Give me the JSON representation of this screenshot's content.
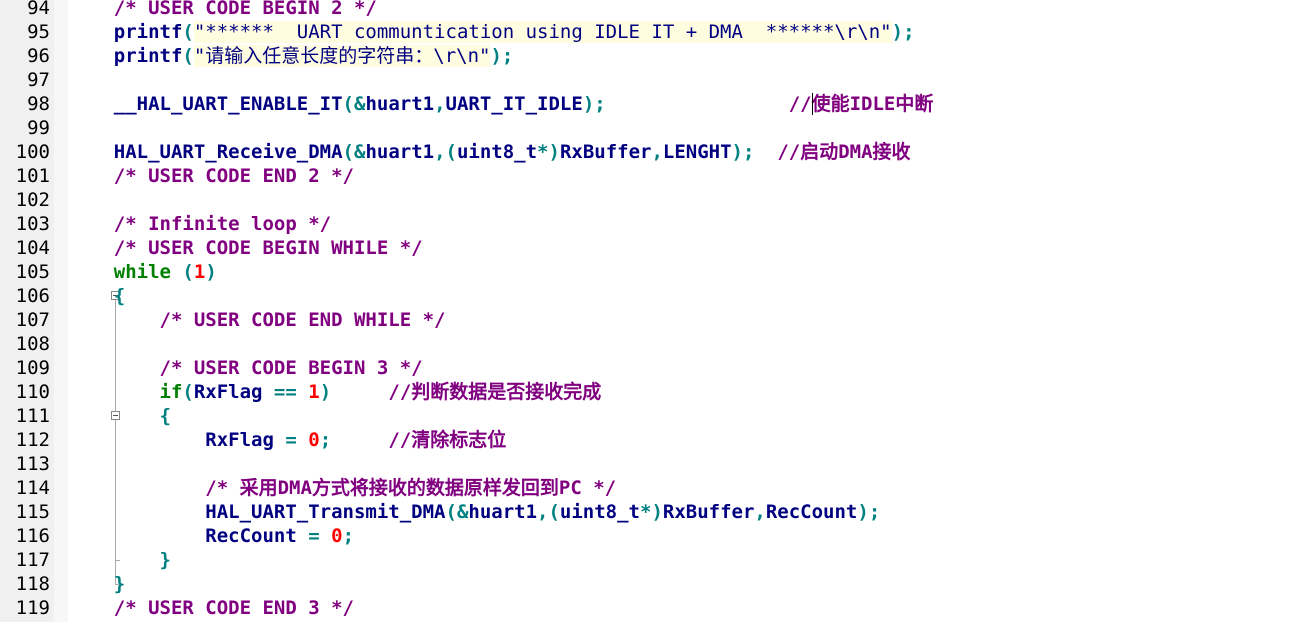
{
  "editor": {
    "lines": [
      {
        "num": "94",
        "segments": [
          {
            "c": "cmt",
            "t": "    /* USER CODE BEGIN 2 */"
          }
        ]
      },
      {
        "num": "95",
        "segments": [
          {
            "c": "fn",
            "t": "    printf"
          },
          {
            "c": "op",
            "t": "("
          },
          {
            "c": "str",
            "t": "\"******  UART communtication using IDLE IT + DMA  ******\\r\\n\""
          },
          {
            "c": "op",
            "t": ");"
          }
        ]
      },
      {
        "num": "96",
        "segments": [
          {
            "c": "fn",
            "t": "    printf"
          },
          {
            "c": "op",
            "t": "("
          },
          {
            "c": "str",
            "t": "\"请输入任意长度的字符串：\\r\\n\""
          },
          {
            "c": "op",
            "t": ");"
          }
        ]
      },
      {
        "num": "97",
        "segments": []
      },
      {
        "num": "98",
        "segments": [
          {
            "c": "plain",
            "t": "    __HAL_UART_ENABLE_IT"
          },
          {
            "c": "op",
            "t": "(&"
          },
          {
            "c": "plain",
            "t": "huart1"
          },
          {
            "c": "op",
            "t": ","
          },
          {
            "c": "plain",
            "t": "UART_IT_IDLE"
          },
          {
            "c": "op",
            "t": ");"
          },
          {
            "c": "plain",
            "t": "                "
          },
          {
            "c": "cmt",
            "t": "//使能IDLE中断"
          }
        ]
      },
      {
        "num": "99",
        "segments": []
      },
      {
        "num": "100",
        "segments": [
          {
            "c": "plain",
            "t": "    HAL_UART_Receive_DMA"
          },
          {
            "c": "op",
            "t": "(&"
          },
          {
            "c": "plain",
            "t": "huart1"
          },
          {
            "c": "op",
            "t": ",("
          },
          {
            "c": "plain",
            "t": "uint8_t"
          },
          {
            "c": "op",
            "t": "*)"
          },
          {
            "c": "plain",
            "t": "RxBuffer"
          },
          {
            "c": "op",
            "t": ","
          },
          {
            "c": "plain",
            "t": "LENGHT"
          },
          {
            "c": "op",
            "t": ");"
          },
          {
            "c": "plain",
            "t": "  "
          },
          {
            "c": "cmt",
            "t": "//启动DMA接收"
          }
        ]
      },
      {
        "num": "101",
        "segments": [
          {
            "c": "cmt",
            "t": "    /* USER CODE END 2 */"
          }
        ]
      },
      {
        "num": "102",
        "segments": []
      },
      {
        "num": "103",
        "segments": [
          {
            "c": "cmt",
            "t": "    /* Infinite loop */"
          }
        ]
      },
      {
        "num": "104",
        "segments": [
          {
            "c": "cmt",
            "t": "    /* USER CODE BEGIN WHILE */"
          }
        ]
      },
      {
        "num": "105",
        "segments": [
          {
            "c": "kw",
            "t": "    while"
          },
          {
            "c": "plain",
            "t": " "
          },
          {
            "c": "op",
            "t": "("
          },
          {
            "c": "num",
            "t": "1"
          },
          {
            "c": "op",
            "t": ")"
          }
        ]
      },
      {
        "num": "106",
        "segments": [
          {
            "c": "op",
            "t": "    {"
          }
        ]
      },
      {
        "num": "107",
        "segments": [
          {
            "c": "cmt",
            "t": "        /* USER CODE END WHILE */"
          }
        ]
      },
      {
        "num": "108",
        "segments": []
      },
      {
        "num": "109",
        "segments": [
          {
            "c": "cmt",
            "t": "        /* USER CODE BEGIN 3 */"
          }
        ]
      },
      {
        "num": "110",
        "segments": [
          {
            "c": "kw",
            "t": "        if"
          },
          {
            "c": "op",
            "t": "("
          },
          {
            "c": "plain",
            "t": "RxFlag "
          },
          {
            "c": "op",
            "t": "=="
          },
          {
            "c": "plain",
            "t": " "
          },
          {
            "c": "num",
            "t": "1"
          },
          {
            "c": "op",
            "t": ")"
          },
          {
            "c": "plain",
            "t": "     "
          },
          {
            "c": "cmt",
            "t": "//判断数据是否接收完成"
          }
        ]
      },
      {
        "num": "111",
        "segments": [
          {
            "c": "op",
            "t": "        {"
          }
        ]
      },
      {
        "num": "112",
        "segments": [
          {
            "c": "plain",
            "t": "            RxFlag "
          },
          {
            "c": "op",
            "t": "="
          },
          {
            "c": "plain",
            "t": " "
          },
          {
            "c": "num",
            "t": "0"
          },
          {
            "c": "op",
            "t": ";"
          },
          {
            "c": "plain",
            "t": "     "
          },
          {
            "c": "cmt",
            "t": "//清除标志位"
          }
        ]
      },
      {
        "num": "113",
        "segments": []
      },
      {
        "num": "114",
        "segments": [
          {
            "c": "cmt",
            "t": "            /* 采用DMA方式将接收的数据原样发回到PC */"
          }
        ]
      },
      {
        "num": "115",
        "segments": [
          {
            "c": "plain",
            "t": "            HAL_UART_Transmit_DMA"
          },
          {
            "c": "op",
            "t": "(&"
          },
          {
            "c": "plain",
            "t": "huart1"
          },
          {
            "c": "op",
            "t": ",("
          },
          {
            "c": "plain",
            "t": "uint8_t"
          },
          {
            "c": "op",
            "t": "*)"
          },
          {
            "c": "plain",
            "t": "RxBuffer"
          },
          {
            "c": "op",
            "t": ","
          },
          {
            "c": "plain",
            "t": "RecCount"
          },
          {
            "c": "op",
            "t": ");"
          }
        ]
      },
      {
        "num": "116",
        "segments": [
          {
            "c": "plain",
            "t": "            RecCount "
          },
          {
            "c": "op",
            "t": "="
          },
          {
            "c": "plain",
            "t": " "
          },
          {
            "c": "num",
            "t": "0"
          },
          {
            "c": "op",
            "t": ";"
          }
        ]
      },
      {
        "num": "117",
        "segments": [
          {
            "c": "op",
            "t": "        }"
          }
        ]
      },
      {
        "num": "118",
        "segments": [
          {
            "c": "op",
            "t": "    }"
          }
        ]
      },
      {
        "num": "119",
        "segments": [
          {
            "c": "cmt",
            "t": "    /* USER CODE END 3 */"
          }
        ]
      }
    ]
  }
}
